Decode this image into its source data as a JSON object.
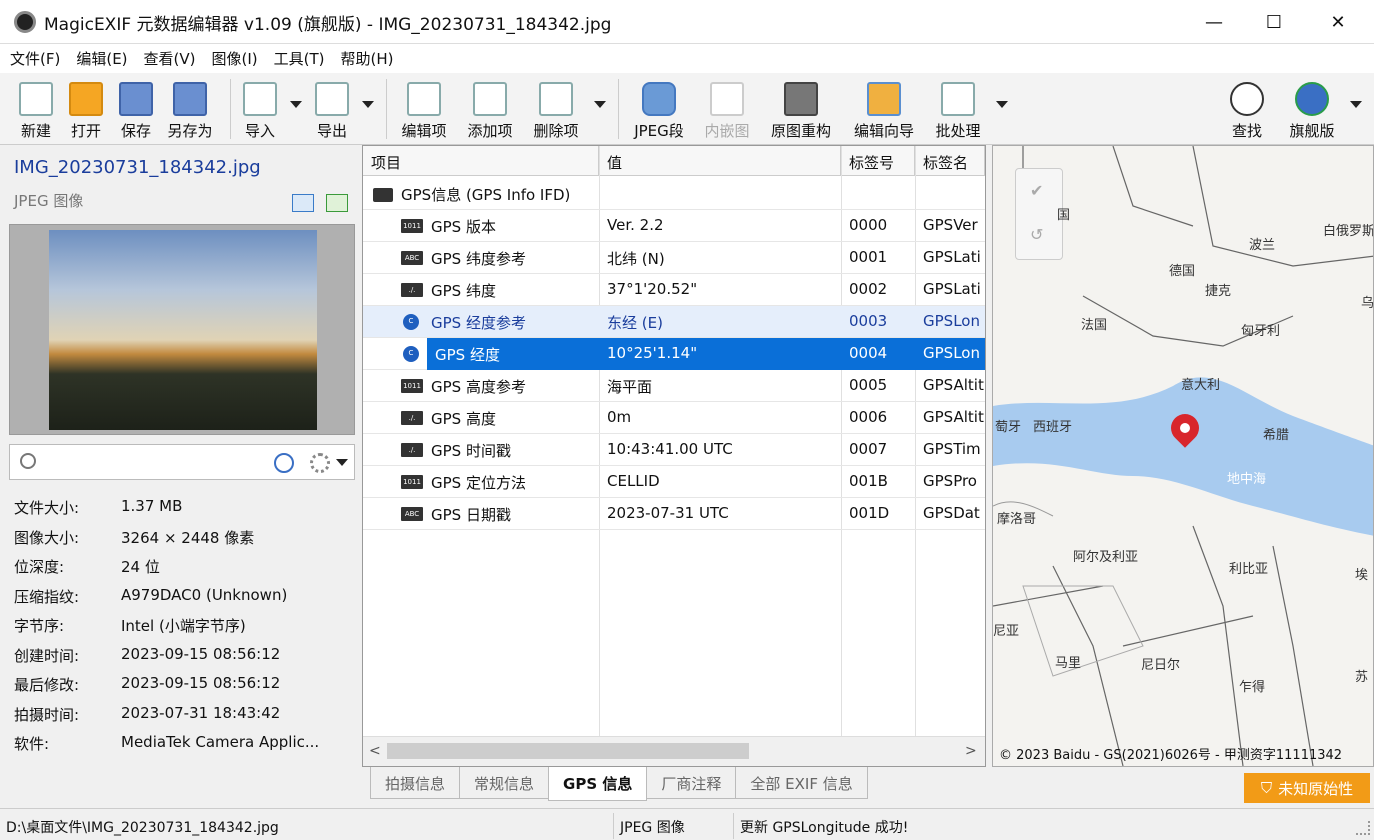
{
  "window": {
    "title": "MagicEXIF 元数据编辑器 v1.09 (旗舰版) - IMG_20230731_184342.jpg",
    "min": "—",
    "max": "☐",
    "close": "✕"
  },
  "menu": [
    "文件(F)",
    "编辑(E)",
    "查看(V)",
    "图像(I)",
    "工具(T)",
    "帮助(H)"
  ],
  "toolbar": {
    "new": "新建",
    "open": "打开",
    "save": "保存",
    "save_as": "另存为",
    "import": "导入",
    "export": "导出",
    "edit_item": "编辑项",
    "add_item": "添加项",
    "delete_item": "删除项",
    "jpeg_seg": "JPEG段",
    "embedded": "内嵌图",
    "rebuild": "原图重构",
    "wizard": "编辑向导",
    "batch": "批处理",
    "find": "查找",
    "flagship": "旗舰版"
  },
  "file_panel": {
    "filename": "IMG_20230731_184342.jpg",
    "filetype": "JPEG 图像",
    "search_placeholder": "",
    "props": [
      {
        "label": "文件大小:",
        "value": "1.37 MB"
      },
      {
        "label": "图像大小:",
        "value": "3264 × 2448 像素"
      },
      {
        "label": "位深度:",
        "value": "24 位"
      },
      {
        "label": "压缩指纹:",
        "value": "A979DAC0 (Unknown)"
      },
      {
        "label": "字节序:",
        "value": "Intel (小端字节序)"
      },
      {
        "label": "创建时间:",
        "value": "2023-09-15 08:56:12"
      },
      {
        "label": "最后修改:",
        "value": "2023-09-15 08:56:12"
      },
      {
        "label": "拍摄时间:",
        "value": "2023-07-31 18:43:42"
      },
      {
        "label": "软件:",
        "value": "MediaTek Camera Applic..."
      }
    ]
  },
  "grid": {
    "headers": [
      "项目",
      "值",
      "标签号",
      "标签名"
    ],
    "group": "GPS信息 (GPS Info IFD)",
    "rows": [
      {
        "icon": "1011",
        "name": "GPS 版本",
        "value": "Ver. 2.2",
        "tag": "0000",
        "tagname": "GPSVer"
      },
      {
        "icon": "ABC",
        "name": "GPS 纬度参考",
        "value": "北纬 (N)",
        "tag": "0001",
        "tagname": "GPSLati"
      },
      {
        "icon": "./.",
        "name": "GPS 纬度",
        "value": "37°1'20.52\"",
        "tag": "0002",
        "tagname": "GPSLati"
      },
      {
        "icon": "C",
        "name": "GPS 经度参考",
        "value": "东经 (E)",
        "tag": "0003",
        "tagname": "GPSLon"
      },
      {
        "icon": "C",
        "name": "GPS 经度",
        "value": "10°25'1.14\"",
        "tag": "0004",
        "tagname": "GPSLon"
      },
      {
        "icon": "1011",
        "name": "GPS 高度参考",
        "value": "海平面",
        "tag": "0005",
        "tagname": "GPSAltit"
      },
      {
        "icon": "./.",
        "name": "GPS 高度",
        "value": "0m",
        "tag": "0006",
        "tagname": "GPSAltit"
      },
      {
        "icon": "./.",
        "name": "GPS 时间戳",
        "value": "10:43:41.00 UTC",
        "tag": "0007",
        "tagname": "GPSTim"
      },
      {
        "icon": "1011",
        "name": "GPS 定位方法",
        "value": "CELLID",
        "tag": "001B",
        "tagname": "GPSPro"
      },
      {
        "icon": "ABC",
        "name": "GPS 日期戳",
        "value": "2023-07-31 UTC",
        "tag": "001D",
        "tagname": "GPSDat"
      }
    ]
  },
  "map": {
    "labels": [
      "国",
      "白俄罗斯",
      "波兰",
      "德国",
      "捷克",
      "乌",
      "法国",
      "匈牙利",
      "意大利",
      "萄牙",
      "西班牙",
      "希腊",
      "地中海",
      "摩洛哥",
      "阿尔及利亚",
      "利比亚",
      "埃",
      "尼亚",
      "马里",
      "尼日尔",
      "乍得",
      "苏"
    ],
    "copyright": "© 2023 Baidu - GS(2021)6026号 - 甲测资字11111342"
  },
  "tabs": [
    "拍摄信息",
    "常规信息",
    "GPS 信息",
    "厂商注释",
    "全部 EXIF 信息"
  ],
  "badge": "未知原始性",
  "status": {
    "path": "D:\\桌面文件\\IMG_20230731_184342.jpg",
    "type": "JPEG 图像",
    "message": "更新 GPSLongitude 成功!"
  }
}
